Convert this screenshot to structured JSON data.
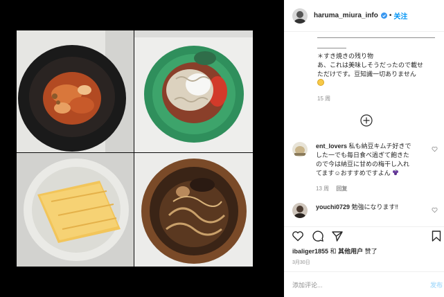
{
  "post": {
    "username": "haruma_miura_info",
    "separator": "•",
    "follow_label": "关注",
    "caption_lines": [
      "＊すき焼きの残り物",
      "あ、これは美味しそうだったので載せ",
      "ただけです。豆知識一切ありません"
    ],
    "caption_emoji": "grinning-sweat-emoji",
    "time": "15 周",
    "load_more_icon": "plus-circle-icon"
  },
  "comments": [
    {
      "user": "ent_lovers",
      "text_lines": [
        "私も納豆キムチ好きで",
        "した一でも毎日食べ過ぎて飽きた",
        "ので今は納豆に甘めの梅干し入れ",
        "てます☺おすすめですよん"
      ],
      "emoji": "grapes-emoji",
      "time": "13 周",
      "reply_label": "回复"
    },
    {
      "user": "youchi0729",
      "text_lines": [
        "勉強になります‼"
      ]
    }
  ],
  "actions": {
    "like_icon": "heart-icon",
    "comment_icon": "comment-bubble-icon",
    "share_icon": "paper-plane-icon",
    "save_icon": "bookmark-icon"
  },
  "likes": {
    "user": "ibaliger1855",
    "and": "和",
    "others": "其他用户",
    "suffix": "赞了"
  },
  "date": "3月30日",
  "compose": {
    "placeholder": "添加评论...",
    "post_label": "发布"
  },
  "colors": {
    "accent": "#0095f6",
    "text": "#262626",
    "muted": "#8e8e8e"
  }
}
